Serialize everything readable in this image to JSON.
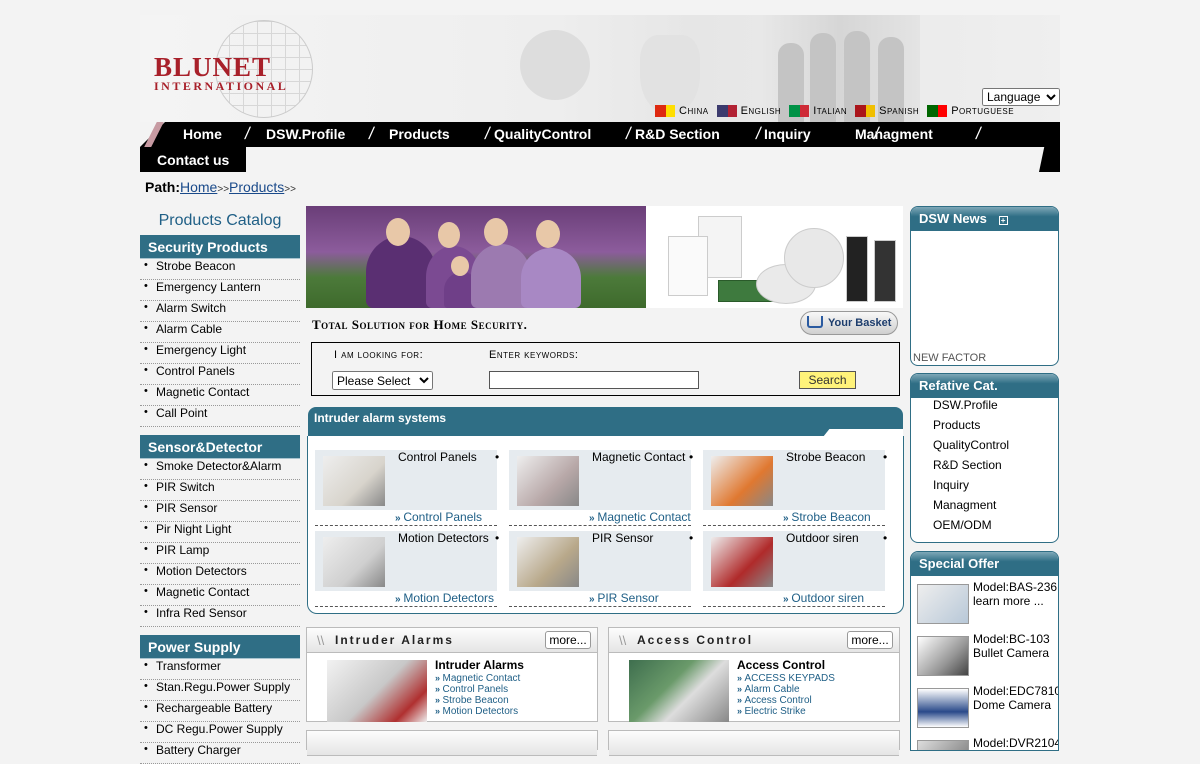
{
  "brand": {
    "name": "BLUNET",
    "sub": "INTERNATIONAL"
  },
  "language": {
    "select": "Language",
    "options": [
      {
        "label": "China",
        "flag": [
          "#de2910",
          "#ffde00"
        ]
      },
      {
        "label": "English",
        "flag": [
          "#3c3b6e",
          "#b22234"
        ]
      },
      {
        "label": "Italian",
        "flag": [
          "#009246",
          "#ce2b37"
        ]
      },
      {
        "label": "Spanish",
        "flag": [
          "#aa151b",
          "#f1bf00"
        ]
      },
      {
        "label": "Portuguese",
        "flag": [
          "#006600",
          "#ff0000"
        ]
      }
    ]
  },
  "nav": [
    "Home",
    "DSW.Profile",
    "Products",
    "QualityControl",
    "R&D Section",
    "Inquiry",
    "Managment"
  ],
  "nav2": "Contact us",
  "path": {
    "label": "Path:",
    "crumbs": [
      "Home",
      "Products"
    ],
    "sep": ">>"
  },
  "catalog": {
    "title": "Products Catalog",
    "sections": [
      {
        "title": "Security Products",
        "items": [
          "Strobe Beacon",
          "Emergency Lantern",
          "Alarm Switch",
          "Alarm Cable",
          "Emergency Light",
          "Control Panels",
          "Magnetic Contact",
          "Call Point"
        ]
      },
      {
        "title": "Sensor&Detector",
        "items": [
          "Smoke Detector&Alarm",
          "PIR Switch",
          "PIR Sensor",
          "Pir Night Light",
          "PIR Lamp",
          "Motion Detectors",
          "Magnetic Contact",
          "Infra Red Sensor"
        ]
      },
      {
        "title": "Power Supply",
        "items": [
          "Transformer",
          "Stan.Regu.Power Supply",
          "Rechargeable Battery",
          "DC Regu.Power Supply",
          "Battery Charger"
        ]
      }
    ]
  },
  "tagline": "Total Solution for Home Security.",
  "basket": "Your Basket",
  "search": {
    "looking_label": "I am looking for:",
    "select": "Please Select",
    "keywords_label": "Enter keywords:",
    "button": "Search"
  },
  "intruder": {
    "title": "Intruder alarm systems",
    "cards": [
      {
        "name": "Control Panels",
        "link": "Control Panels"
      },
      {
        "name": "Magnetic Contact",
        "link": "Magnetic Contact"
      },
      {
        "name": "Strobe Beacon",
        "link": "Strobe Beacon"
      },
      {
        "name": "Motion Detectors",
        "link": "Motion Detectors"
      },
      {
        "name": "PIR Sensor",
        "link": "PIR Sensor"
      },
      {
        "name": "Outdoor siren",
        "link": "Outdoor siren"
      }
    ]
  },
  "panels": [
    {
      "head": "Intruder Alarms",
      "more": "more...",
      "title": "Intruder Alarms",
      "links": [
        "Magnetic Contact",
        "Control Panels",
        "Strobe Beacon",
        "Motion Detectors"
      ]
    },
    {
      "head": "Access Control",
      "more": "more...",
      "title": "Access Control",
      "links": [
        "ACCESS KEYPADS",
        "Alarm Cable",
        "Access Control",
        "Electric Strike"
      ]
    }
  ],
  "news": {
    "title": "DSW News",
    "ticker": "NEW FACTOR"
  },
  "refcat": {
    "title": "Refative Cat.",
    "items": [
      "DSW.Profile",
      "Products",
      "QualityControl",
      "R&D Section",
      "Inquiry",
      "Managment",
      "OEM/ODM"
    ]
  },
  "offer": {
    "title": "Special Offer",
    "items": [
      {
        "line1": "Model:BAS-236",
        "line2": "learn more ..."
      },
      {
        "line1": "Model:BC-103",
        "line2": "Bullet Camera"
      },
      {
        "line1": "Model:EDC7810",
        "line2": "Dome Camera"
      },
      {
        "line1": "Model:DVR2104",
        "line2": ""
      }
    ]
  }
}
